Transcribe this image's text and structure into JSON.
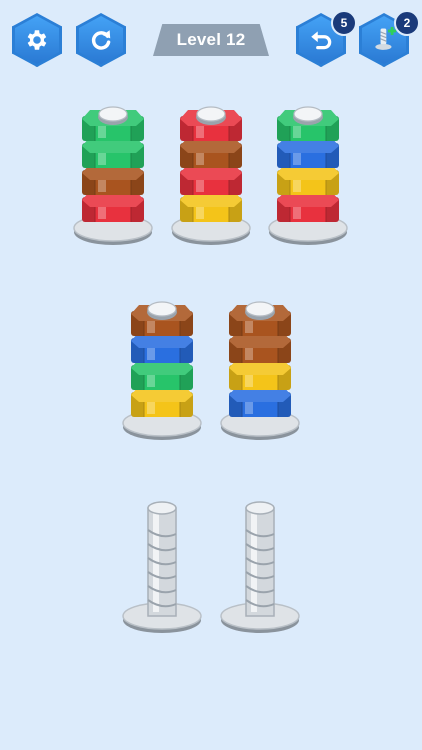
{
  "header": {
    "settings_icon": "gear-icon",
    "restart_icon": "restart-icon",
    "level_label": "Level 12",
    "undo_icon": "undo-icon",
    "undo_count": "5",
    "add_bolt_icon": "add-bolt-icon",
    "add_bolt_count": "2"
  },
  "colors": {
    "green": "#27c46a",
    "red": "#e8313e",
    "brown": "#a9541f",
    "blue": "#2a6fe0",
    "yellow": "#f4c419",
    "background": "#dcebfb",
    "button_blue": "#2b7fd6",
    "plate_grey": "#8fa0b2"
  },
  "bolts": [
    {
      "name": "bolt-1",
      "nuts": [
        "red",
        "brown",
        "green",
        "green"
      ]
    },
    {
      "name": "bolt-2",
      "nuts": [
        "yellow",
        "red",
        "brown",
        "red"
      ]
    },
    {
      "name": "bolt-3",
      "nuts": [
        "red",
        "yellow",
        "blue",
        "green"
      ]
    },
    {
      "name": "bolt-4",
      "nuts": [
        "yellow",
        "green",
        "blue",
        "brown"
      ]
    },
    {
      "name": "bolt-5",
      "nuts": [
        "blue",
        "yellow",
        "brown",
        "brown"
      ]
    },
    {
      "name": "bolt-6",
      "nuts": []
    },
    {
      "name": "bolt-7",
      "nuts": []
    }
  ]
}
